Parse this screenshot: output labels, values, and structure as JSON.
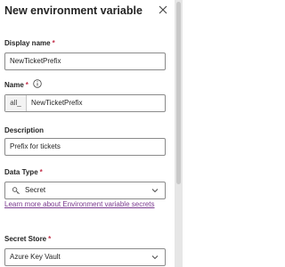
{
  "panel": {
    "title": "New environment variable"
  },
  "display_name": {
    "label": "Display name",
    "required_mark": "*",
    "value": "NewTicketPrefix"
  },
  "name": {
    "label": "Name",
    "required_mark": "*",
    "prefix": "all_",
    "value": "NewTicketPrefix"
  },
  "description": {
    "label": "Description",
    "value": "Prefix for tickets"
  },
  "data_type": {
    "label": "Data Type",
    "required_mark": "*",
    "value": "Secret",
    "link": "Learn more about Environment variable secrets"
  },
  "secret_store": {
    "label": "Secret Store",
    "required_mark": "*",
    "value": "Azure Key Vault"
  },
  "colors": {
    "accent_link": "#7a3a8f",
    "required": "#c4314b",
    "border": "#8a8a8a"
  },
  "icons": [
    "close-icon",
    "info-icon",
    "lock-icon",
    "chevron-down-icon"
  ]
}
